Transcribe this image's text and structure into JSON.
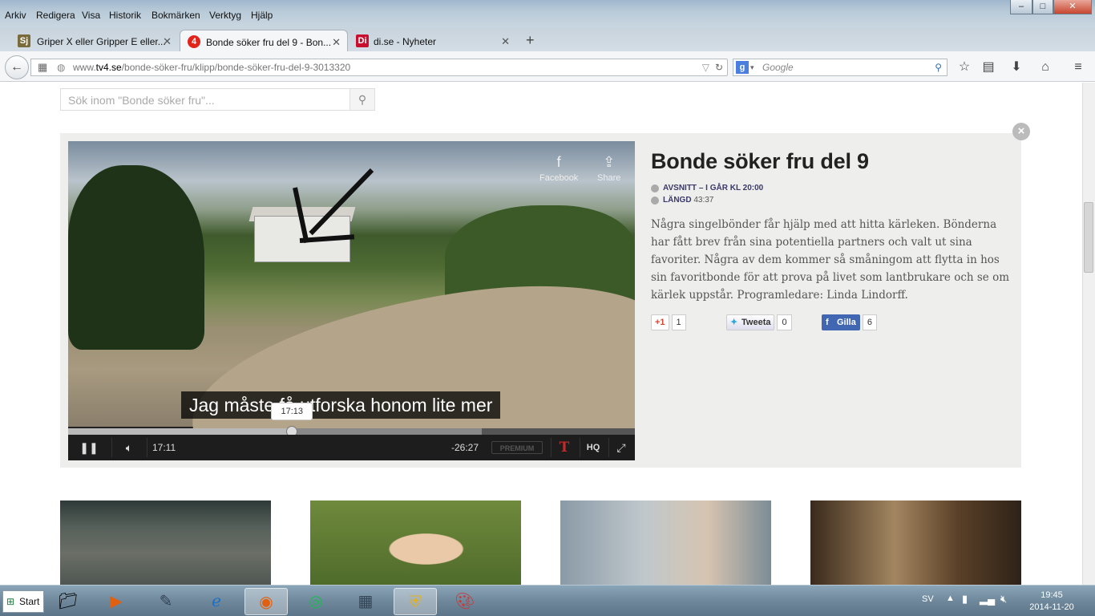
{
  "menubar": {
    "items": [
      "Arkiv",
      "Redigera",
      "Visa",
      "Historik",
      "Bokmärken",
      "Verktyg",
      "Hjälp"
    ]
  },
  "window_controls": {
    "minimize": "–",
    "maximize": "□",
    "close": "✕"
  },
  "tabs": [
    {
      "title": "Griper X eller Gripper E eller...",
      "favicon": "Sj",
      "favicon_color": "#7a6b3c",
      "active": false
    },
    {
      "title": "Bonde söker fru del 9 - Bon...",
      "favicon": "4",
      "favicon_color": "#e2231a",
      "active": true
    },
    {
      "title": "di.se - Nyheter",
      "favicon": "Di",
      "favicon_color": "#c8102e",
      "active": false
    }
  ],
  "new_tab_label": "+",
  "address": {
    "prefix": "www.",
    "domain": "tv4.se",
    "path": "/bonde-söker-fru/klipp/bonde-söker-fru-del-9-3013320"
  },
  "search": {
    "engine_icon": "google-icon",
    "placeholder": "Google"
  },
  "site_search": {
    "placeholder": "Sök inom \"Bonde söker fru\"..."
  },
  "player": {
    "share_facebook": "Facebook",
    "share_share": "Share",
    "subtitle": "Jag måste få utforska honom lite mer",
    "tooltip_time": "17:13",
    "current_time": "17:11",
    "remaining_time": "-26:27",
    "premium_label": "PREMIUM",
    "hq_label": "HQ",
    "progress_played": 0.395,
    "progress_buffered": 0.73
  },
  "show": {
    "title": "Bonde söker fru del 9",
    "episode_label": "AVSNITT",
    "episode_value": "– I GÅR KL 20:00",
    "length_label": "LÄNGD",
    "length_value": "43:37",
    "description": "Några singelbönder får hjälp med att hitta kärleken. Bönderna har fått brev från sina potentiella partners och valt ut sina favoriter. Några av dem kommer så småningom att flytta in hos sin favoritbonde för att prova på livet som lantbrukare och se om kärlek uppstår. Programledare: Linda Lindorff."
  },
  "social": {
    "gplus_label": "+1",
    "gplus_count": "1",
    "tweet_label": "Tweeta",
    "tweet_count": "0",
    "fb_label": "Gilla",
    "fb_count": "6"
  },
  "taskbar": {
    "start_label": "Start",
    "language": "SV",
    "time": "19:45",
    "date": "2014-11-20"
  }
}
